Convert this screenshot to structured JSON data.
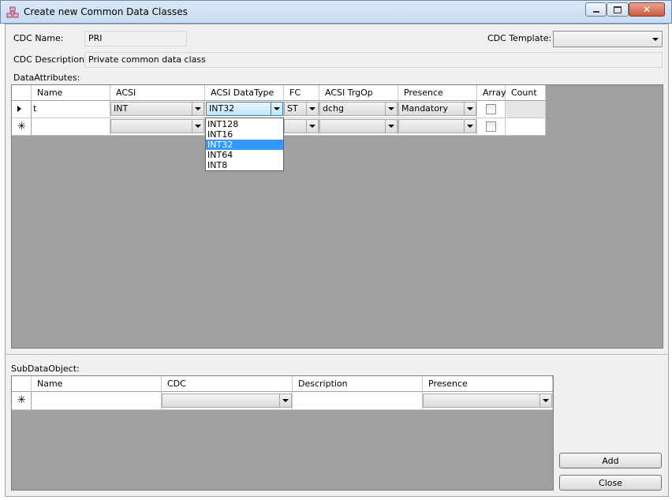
{
  "window": {
    "title": "Create new Common Data Classes",
    "icon": "app-icon",
    "controls": [
      "minimize-icon",
      "maximize-icon",
      "close-icon"
    ]
  },
  "form": {
    "cdc_name_label": "CDC Name:",
    "cdc_name_value": "PRI",
    "cdc_template_label": "CDC Template:",
    "cdc_template_value": "",
    "cdc_description_label": "CDC Description:",
    "cdc_description_value": "Private common data class"
  },
  "data_attributes": {
    "label": "DataAttributes:",
    "columns": [
      "Name",
      "ACSI",
      "ACSI DataType",
      "FC",
      "ACSI TrgOp",
      "Presence",
      "Array",
      "Count"
    ],
    "rows": [
      {
        "marker": "current-row-icon",
        "name": "t",
        "acsi": "INT",
        "datatype": "INT32",
        "fc": "ST",
        "trgop": "dchg",
        "presence": "Mandatory",
        "array": false,
        "count": ""
      },
      {
        "marker": "new-row-icon",
        "name": "",
        "acsi": "",
        "datatype": "",
        "fc": "",
        "trgop": "",
        "presence": "",
        "array": false,
        "count": ""
      }
    ],
    "datatype_dropdown": {
      "open": true,
      "options": [
        "INT128",
        "INT16",
        "INT32",
        "INT64",
        "INT8"
      ],
      "selected": "INT32"
    }
  },
  "sub_data_object": {
    "label": "SubDataObject:",
    "columns": [
      "Name",
      "CDC",
      "Description",
      "Presence"
    ],
    "rows": [
      {
        "marker": "new-row-icon",
        "name": "",
        "cdc": "",
        "description": "",
        "presence": ""
      }
    ]
  },
  "buttons": {
    "add": "Add",
    "close": "Close"
  },
  "colors": {
    "grid_background": "#a0a0a0",
    "selection": "#3399ff",
    "dialog_background": "#f0f0f0"
  }
}
